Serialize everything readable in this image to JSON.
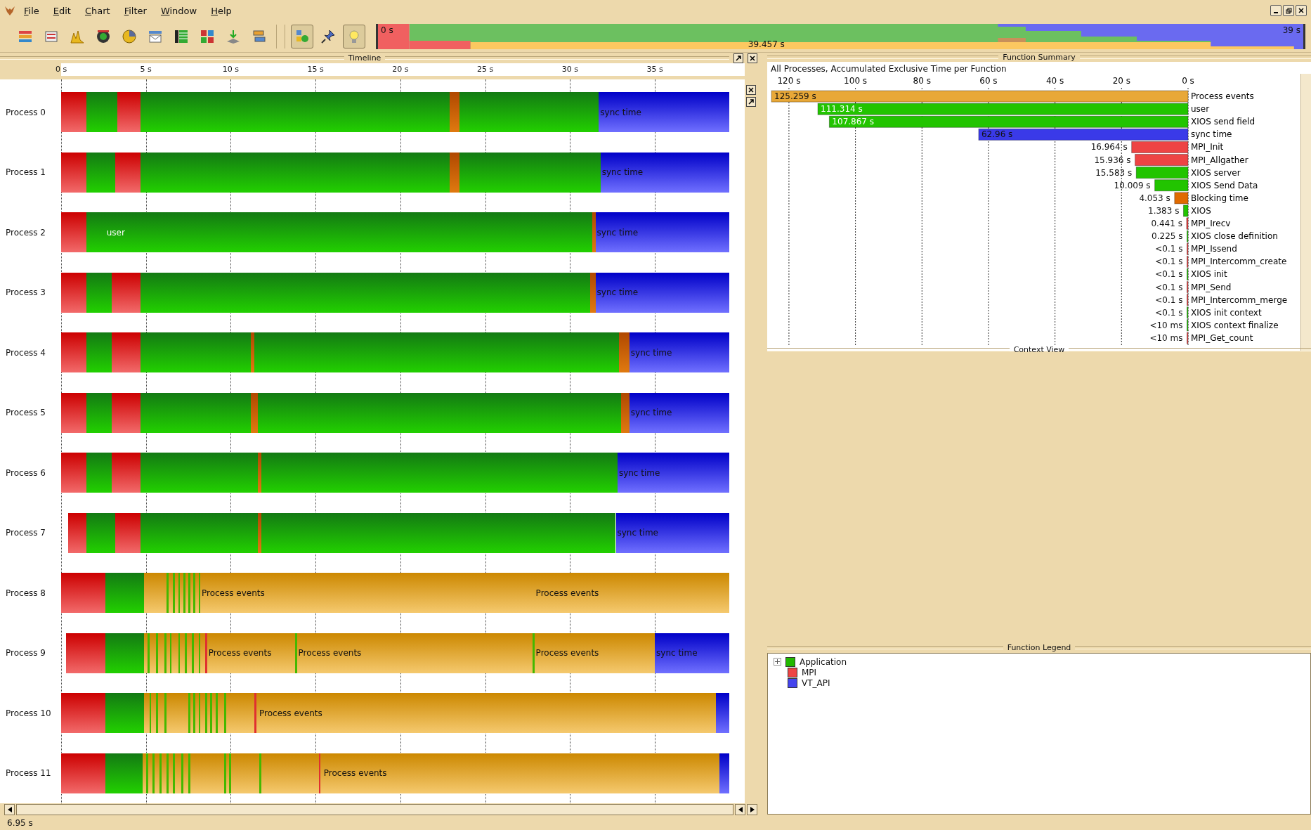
{
  "menu": [
    "File",
    "Edit",
    "Chart",
    "Filter",
    "Window",
    "Help"
  ],
  "toolbar": [
    {
      "pressed": false
    },
    {
      "pressed": false
    },
    {
      "pressed": false
    },
    {
      "pressed": false
    },
    {
      "pressed": false
    },
    {
      "pressed": false
    },
    {
      "pressed": false
    },
    {
      "pressed": false
    },
    {
      "pressed": false
    },
    {
      "pressed": false
    },
    {
      "pressed": true
    },
    {
      "pressed": false
    },
    {
      "pressed": true
    }
  ],
  "overview": {
    "start": "0 s",
    "cursor": "39.457 s",
    "end": "39 s"
  },
  "timeline": {
    "title": "Timeline",
    "ticks": [
      "0 s",
      "5 s",
      "10 s",
      "15 s",
      "20 s",
      "25 s",
      "30 s",
      "35 s"
    ],
    "processes": [
      {
        "name": "Process 0",
        "labels": [
          "sync time"
        ]
      },
      {
        "name": "Process 1",
        "labels": [
          "sync time"
        ]
      },
      {
        "name": "Process 2",
        "labels": [
          "user",
          "sync time"
        ]
      },
      {
        "name": "Process 3",
        "labels": [
          "sync time"
        ]
      },
      {
        "name": "Process 4",
        "labels": [
          "sync time"
        ]
      },
      {
        "name": "Process 5",
        "labels": [
          "sync time"
        ]
      },
      {
        "name": "Process 6",
        "labels": [
          "sync time"
        ]
      },
      {
        "name": "Process 7",
        "labels": [
          "sync time"
        ]
      },
      {
        "name": "Process 8",
        "labels": [
          "Process events",
          "Process events"
        ]
      },
      {
        "name": "Process 9",
        "labels": [
          "Process events",
          "Process events",
          "Process events",
          "sync time"
        ]
      },
      {
        "name": "Process 10",
        "labels": [
          "Process events"
        ]
      },
      {
        "name": "Process 11",
        "labels": [
          "Process events"
        ]
      }
    ]
  },
  "function_summary": {
    "title": "Function Summary",
    "subtitle": "All Processes, Accumulated Exclusive Time per Function",
    "chart_data": {
      "type": "bar",
      "orientation": "horizontal",
      "categories": [
        "Process events",
        "user",
        "XIOS send field",
        "sync time",
        "MPI_Init",
        "MPI_Allgather",
        "XIOS server",
        "XIOS Send Data",
        "Blocking time",
        "XIOS",
        "MPI_Irecv",
        "XIOS close definition",
        "MPI_Issend",
        "MPI_Intercomm_create",
        "XIOS init",
        "MPI_Send",
        "MPI_Intercomm_merge",
        "XIOS init context",
        "XIOS context finalize",
        "MPI_Get_count"
      ],
      "stacked": true,
      "grid": true,
      "series": [
        {
          "color": "#e8a838",
          "values": [
            125.259,
            null,
            null,
            null,
            null,
            null,
            null,
            null,
            null,
            null,
            null,
            null,
            null,
            null,
            null,
            null,
            null,
            null,
            null,
            null
          ]
        },
        {
          "color": "#22c400",
          "values": [
            null,
            111.314,
            107.867,
            null,
            null,
            null,
            15.583,
            10.009,
            null,
            1.383,
            null,
            0.225,
            null,
            null,
            0.05,
            null,
            null,
            0.05,
            0.005,
            null
          ]
        },
        {
          "color": "#3a3ae8",
          "values": [
            null,
            null,
            null,
            62.96,
            null,
            null,
            null,
            null,
            null,
            null,
            null,
            null,
            null,
            null,
            null,
            null,
            null,
            null,
            null,
            null
          ]
        },
        {
          "color": "#ee4444",
          "values": [
            null,
            null,
            null,
            null,
            16.964,
            15.936,
            null,
            null,
            null,
            null,
            0.441,
            null,
            0.05,
            0.05,
            null,
            0.05,
            0.05,
            null,
            null,
            0.005
          ]
        },
        {
          "color": "#e06a00",
          "values": [
            null,
            null,
            null,
            null,
            null,
            null,
            null,
            null,
            4.053,
            null,
            null,
            null,
            null,
            null,
            null,
            null,
            null,
            null,
            null,
            null
          ]
        }
      ],
      "value_labels": [
        "125.259 s",
        "111.314 s",
        "107.867 s",
        "62.96 s",
        "16.964 s",
        "15.936 s",
        "15.583 s",
        "10.009 s",
        "4.053 s",
        "1.383 s",
        "0.441 s",
        "0.225 s",
        "<0.1 s",
        "<0.1 s",
        "<0.1 s",
        "<0.1 s",
        "<0.1 s",
        "<0.1 s",
        "<10 ms",
        "<10 ms"
      ],
      "xlim": [
        125.9,
        0
      ],
      "xticks": [
        {
          "value": 120,
          "label": "120 s"
        },
        {
          "value": 100,
          "label": "100 s"
        },
        {
          "value": 80,
          "label": "80 s"
        },
        {
          "value": 60,
          "label": "60 s"
        },
        {
          "value": 40,
          "label": "40 s"
        },
        {
          "value": 20,
          "label": "20 s"
        },
        {
          "value": 0,
          "label": "0 s"
        }
      ]
    }
  },
  "context_view": {
    "title": "Context View"
  },
  "function_legend": {
    "title": "Function Legend",
    "groups": [
      {
        "name": "Application",
        "color": "#22b800",
        "expanded": false
      },
      {
        "name": "MPI",
        "color": "#ee4444"
      },
      {
        "name": "VT_API",
        "color": "#4444ee"
      }
    ]
  },
  "status_bar": "6.95 s"
}
